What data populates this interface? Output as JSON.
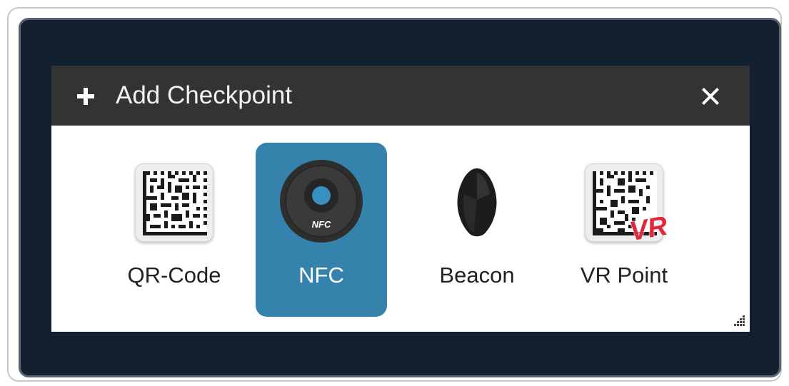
{
  "dialog": {
    "title": "Add Checkpoint",
    "plus_icon": "plus-icon",
    "close_icon": "close-icon"
  },
  "options": [
    {
      "label": "QR-Code",
      "icon": "qr-code-icon",
      "selected": false
    },
    {
      "label": "NFC",
      "icon": "nfc-tag-icon",
      "selected": true,
      "icon_text": "NFC"
    },
    {
      "label": "Beacon",
      "icon": "beacon-icon",
      "selected": false
    },
    {
      "label": "VR Point",
      "icon": "vr-point-icon",
      "selected": false,
      "badge": "VR"
    }
  ],
  "colors": {
    "panel_background": "#12202f",
    "header_background": "#333333",
    "selected_background": "#3583ad",
    "vr_badge": "#e0283a"
  }
}
